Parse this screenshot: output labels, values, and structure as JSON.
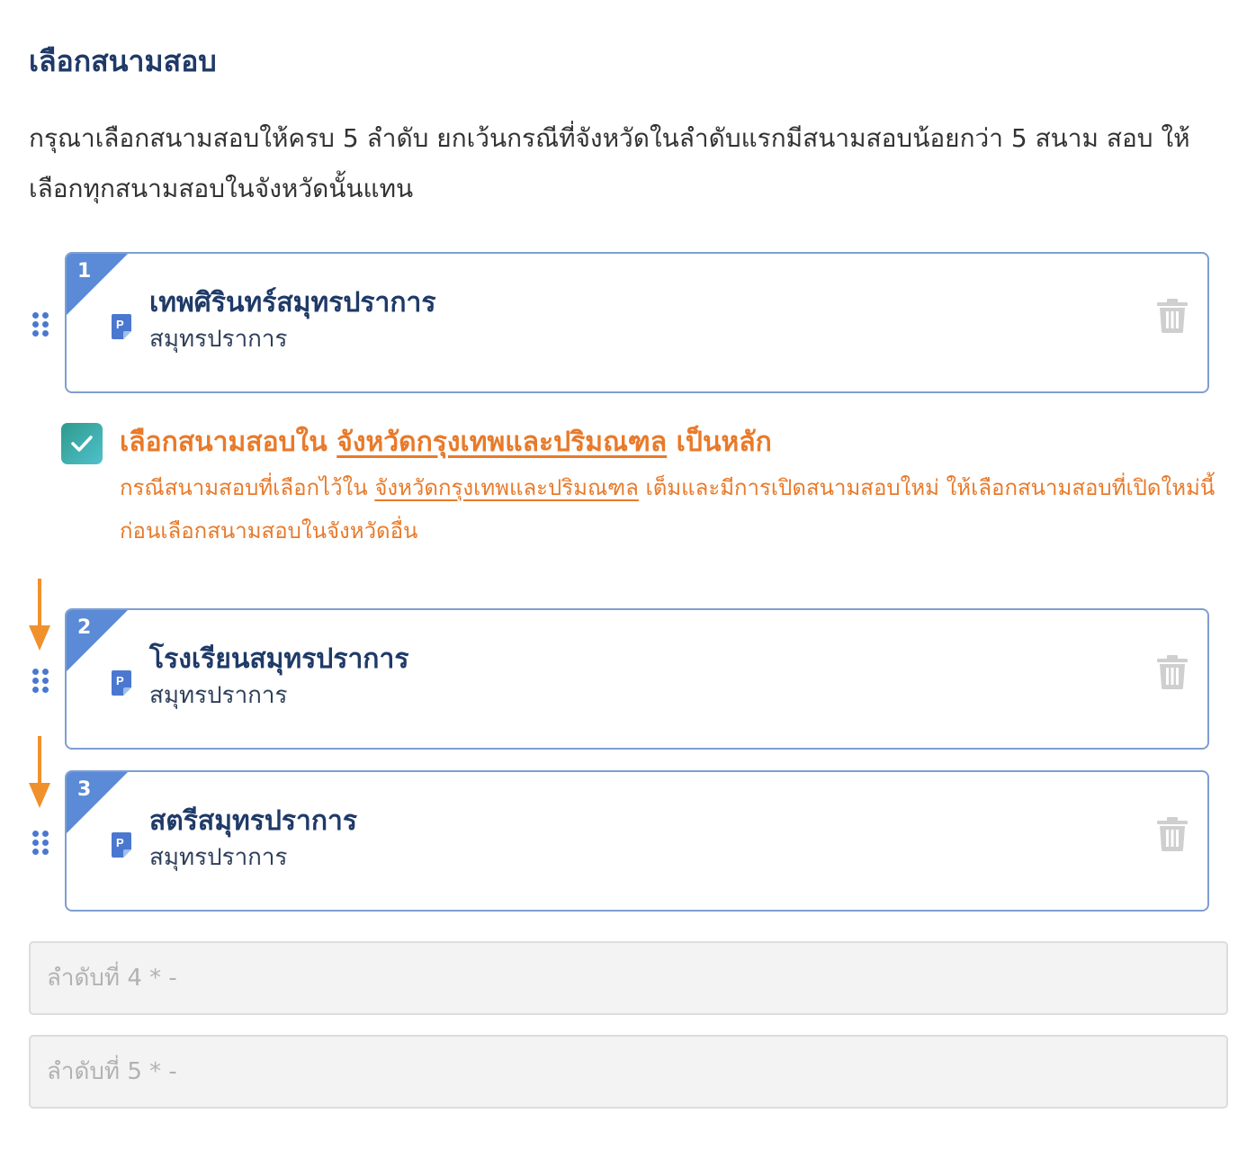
{
  "section": {
    "title": "เลือกสนามสอบ",
    "instructions": "กรุณาเลือกสนามสอบให้ครบ 5 ลำดับ ยกเว้นกรณีที่จังหวัดในลำดับแรกมีสนามสอบน้อยกว่า 5 สนาม สอบ ให้เลือกทุกสนามสอบในจังหวัดนั้นแทน"
  },
  "colors": {
    "accent": "#5b8ad6",
    "title": "#1f3a68",
    "warning": "#e87a2a",
    "checkbox": "#3aa8a6"
  },
  "selected_venues": [
    {
      "rank": "1",
      "name": "เทพศิรินทร์สมุทรปราการ",
      "province": "สมุทรปราการ",
      "icon": "venue-p-icon",
      "delete_icon": "trash-icon"
    },
    {
      "rank": "2",
      "name": "โรงเรียนสมุทรปราการ",
      "province": "สมุทรปราการ",
      "icon": "venue-p-icon",
      "delete_icon": "trash-icon"
    },
    {
      "rank": "3",
      "name": "สตรีสมุทรปราการ",
      "province": "สมุทรปราการ",
      "icon": "venue-p-icon",
      "delete_icon": "trash-icon"
    }
  ],
  "priority_option": {
    "checked": true,
    "label_prefix": "เลือกสนามสอบใน",
    "label_link": "จังหวัดกรุงเทพและปริมณฑล",
    "label_suffix": "เป็นหลัก",
    "note_prefix": "กรณีสนามสอบที่เลือกไว้ใน",
    "note_link": "จังหวัดกรุงเทพและปริมณฑล",
    "note_suffix": "เต็มและมีการเปิดสนามสอบใหม่ ให้เลือกสนามสอบที่เปิดใหม่นี้ก่อนเลือกสนามสอบในจังหวัดอื่น"
  },
  "empty_slots": [
    {
      "placeholder": "ลำดับที่ 4 * -"
    },
    {
      "placeholder": "ลำดับที่ 5 * -"
    }
  ]
}
